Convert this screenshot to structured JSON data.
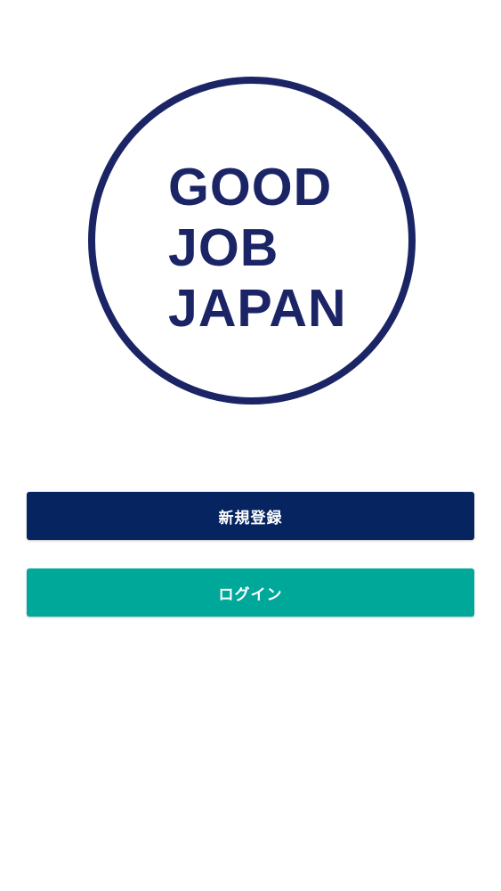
{
  "logo": {
    "lines": [
      "GOOD",
      "JOB",
      "JAPAN"
    ],
    "color": "#1b2566"
  },
  "actions": {
    "register_label": "新規登録",
    "register_color": "#062560",
    "login_label": "ログイン",
    "login_color": "#00a89a"
  }
}
